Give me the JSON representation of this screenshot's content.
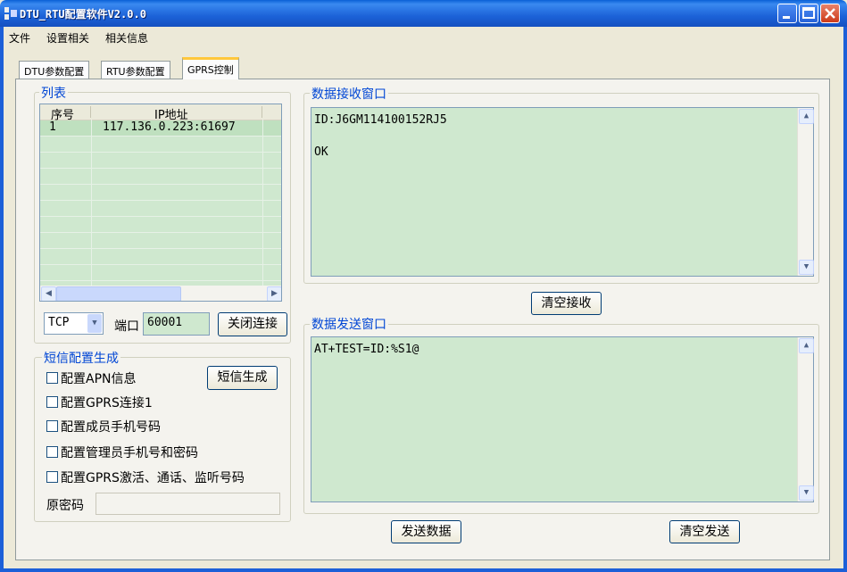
{
  "window": {
    "title": "DTU_RTU配置软件V2.0.0"
  },
  "menu": [
    "文件",
    "设置相关",
    "相关信息"
  ],
  "tabs": [
    "DTU参数配置",
    "RTU参数配置",
    "GPRS控制"
  ],
  "list_group": {
    "title": "列表",
    "columns": [
      "序号",
      "IP地址"
    ],
    "rows": [
      {
        "index": "1",
        "ip": "117.136.0.223:61697"
      }
    ]
  },
  "connection": {
    "protocol": "TCP",
    "port_label": "端口",
    "port_value": "60001",
    "close_button": "关闭连接"
  },
  "sms_group": {
    "title": "短信配置生成",
    "generate_button": "短信生成",
    "options": [
      "配置APN信息",
      "配置GPRS连接1",
      "配置成员手机号码",
      "配置管理员手机号和密码",
      "配置GPRS激活、通话、监听号码"
    ],
    "old_password_label": "原密码",
    "old_password_value": ""
  },
  "receive_group": {
    "title": "数据接收窗口",
    "lines": [
      "ID:J6GM114100152RJ5",
      "",
      "OK"
    ],
    "clear_button": "清空接收"
  },
  "send_group": {
    "title": "数据发送窗口",
    "text": "AT+TEST=ID:%S1@",
    "send_button": "发送数据",
    "clear_button": "清空发送"
  },
  "colors": {
    "titlebar": "#1c62d8",
    "field_bg": "#cfe8cf",
    "group_title": "#0046d5",
    "active_tab_accent": "#ffc83c"
  }
}
